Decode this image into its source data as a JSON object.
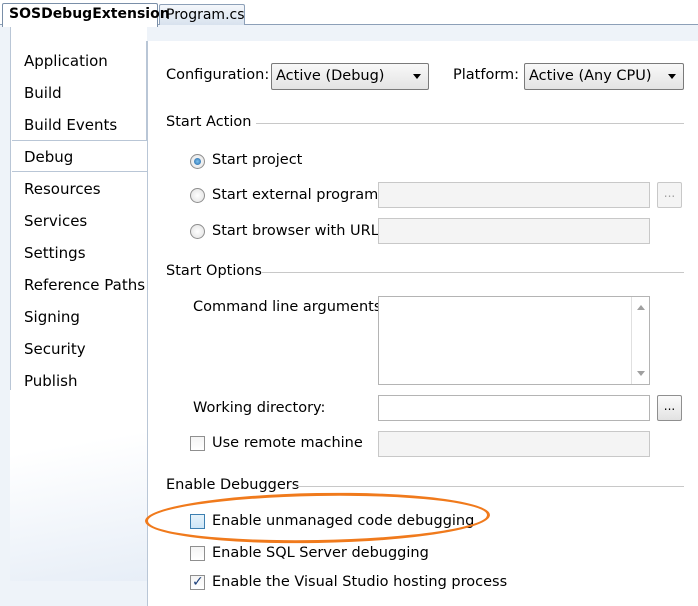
{
  "doc_tabs": [
    {
      "label": "SOSDebugExtension"
    },
    {
      "label": "Program.cs"
    }
  ],
  "nav": {
    "items": [
      {
        "label": "Application"
      },
      {
        "label": "Build"
      },
      {
        "label": "Build Events"
      },
      {
        "label": "Debug"
      },
      {
        "label": "Resources"
      },
      {
        "label": "Services"
      },
      {
        "label": "Settings"
      },
      {
        "label": "Reference Paths"
      },
      {
        "label": "Signing"
      },
      {
        "label": "Security"
      },
      {
        "label": "Publish"
      }
    ],
    "selected": "Debug"
  },
  "toolbar": {
    "configuration_label": "Configuration:",
    "configuration_value": "Active (Debug)",
    "platform_label": "Platform:",
    "platform_value": "Active (Any CPU)"
  },
  "start_action": {
    "title": "Start Action",
    "start_project": "Start project",
    "start_external": "Start external program:",
    "start_browser": "Start browser with URL:",
    "browse_label": "...",
    "selected": "Start project"
  },
  "start_options": {
    "title": "Start Options",
    "cmd_args_label": "Command line arguments:",
    "working_dir_label": "Working directory:",
    "browse_label": "...",
    "use_remote_label": "Use remote machine",
    "use_remote_checked": false
  },
  "debuggers": {
    "title": "Enable Debuggers",
    "unmanaged_label": "Enable unmanaged code debugging",
    "unmanaged_checked": false,
    "sql_label": "Enable SQL Server debugging",
    "sql_checked": false,
    "hosting_label": "Enable the Visual Studio hosting process",
    "hosting_checked": true
  },
  "colors": {
    "highlight": "#f07a1c",
    "border": "#b9c6d6"
  }
}
